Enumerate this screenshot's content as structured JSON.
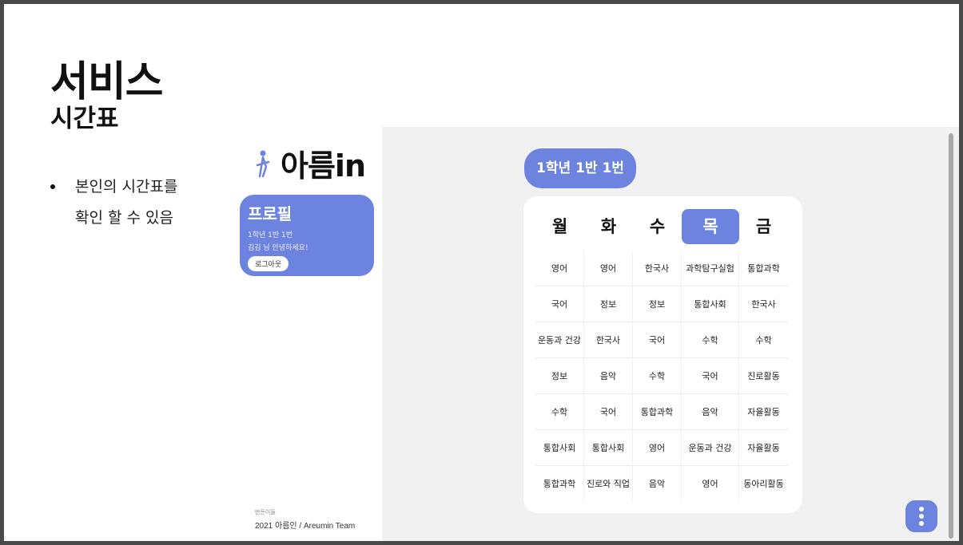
{
  "slide": {
    "title": "서비스",
    "subtitle": "시간표",
    "bullet_lines": "본인의 시간표를\n확인 할 수 있음"
  },
  "app": {
    "logo_text": "아름in",
    "profile": {
      "title": "프로필",
      "class_label": "1학년 1반 1번",
      "greeting": "김김 님 안녕하세요!",
      "logout_label": "로그아웃"
    },
    "footer": {
      "label": "만든이들",
      "team": "2021 아름인 / Areumin Team"
    },
    "class_badge": "1학년 1반 1번",
    "days": [
      "월",
      "화",
      "수",
      "목",
      "금"
    ],
    "active_day": "목",
    "timetable": [
      [
        "영어",
        "영어",
        "한국사",
        "과학탐구실험",
        "통합과학"
      ],
      [
        "국어",
        "정보",
        "정보",
        "통합사회",
        "한국사"
      ],
      [
        "운동과 건강",
        "한국사",
        "국어",
        "수학",
        "수학"
      ],
      [
        "정보",
        "음악",
        "수학",
        "국어",
        "진로활동"
      ],
      [
        "수학",
        "국어",
        "통합과학",
        "음악",
        "자율활동"
      ],
      [
        "통합사회",
        "통합사회",
        "영어",
        "운동과 건강",
        "자율활동"
      ],
      [
        "통합과학",
        "진로와 직업",
        "음악",
        "영어",
        "동아리활동"
      ]
    ],
    "accent_color": "#6c83e0"
  }
}
